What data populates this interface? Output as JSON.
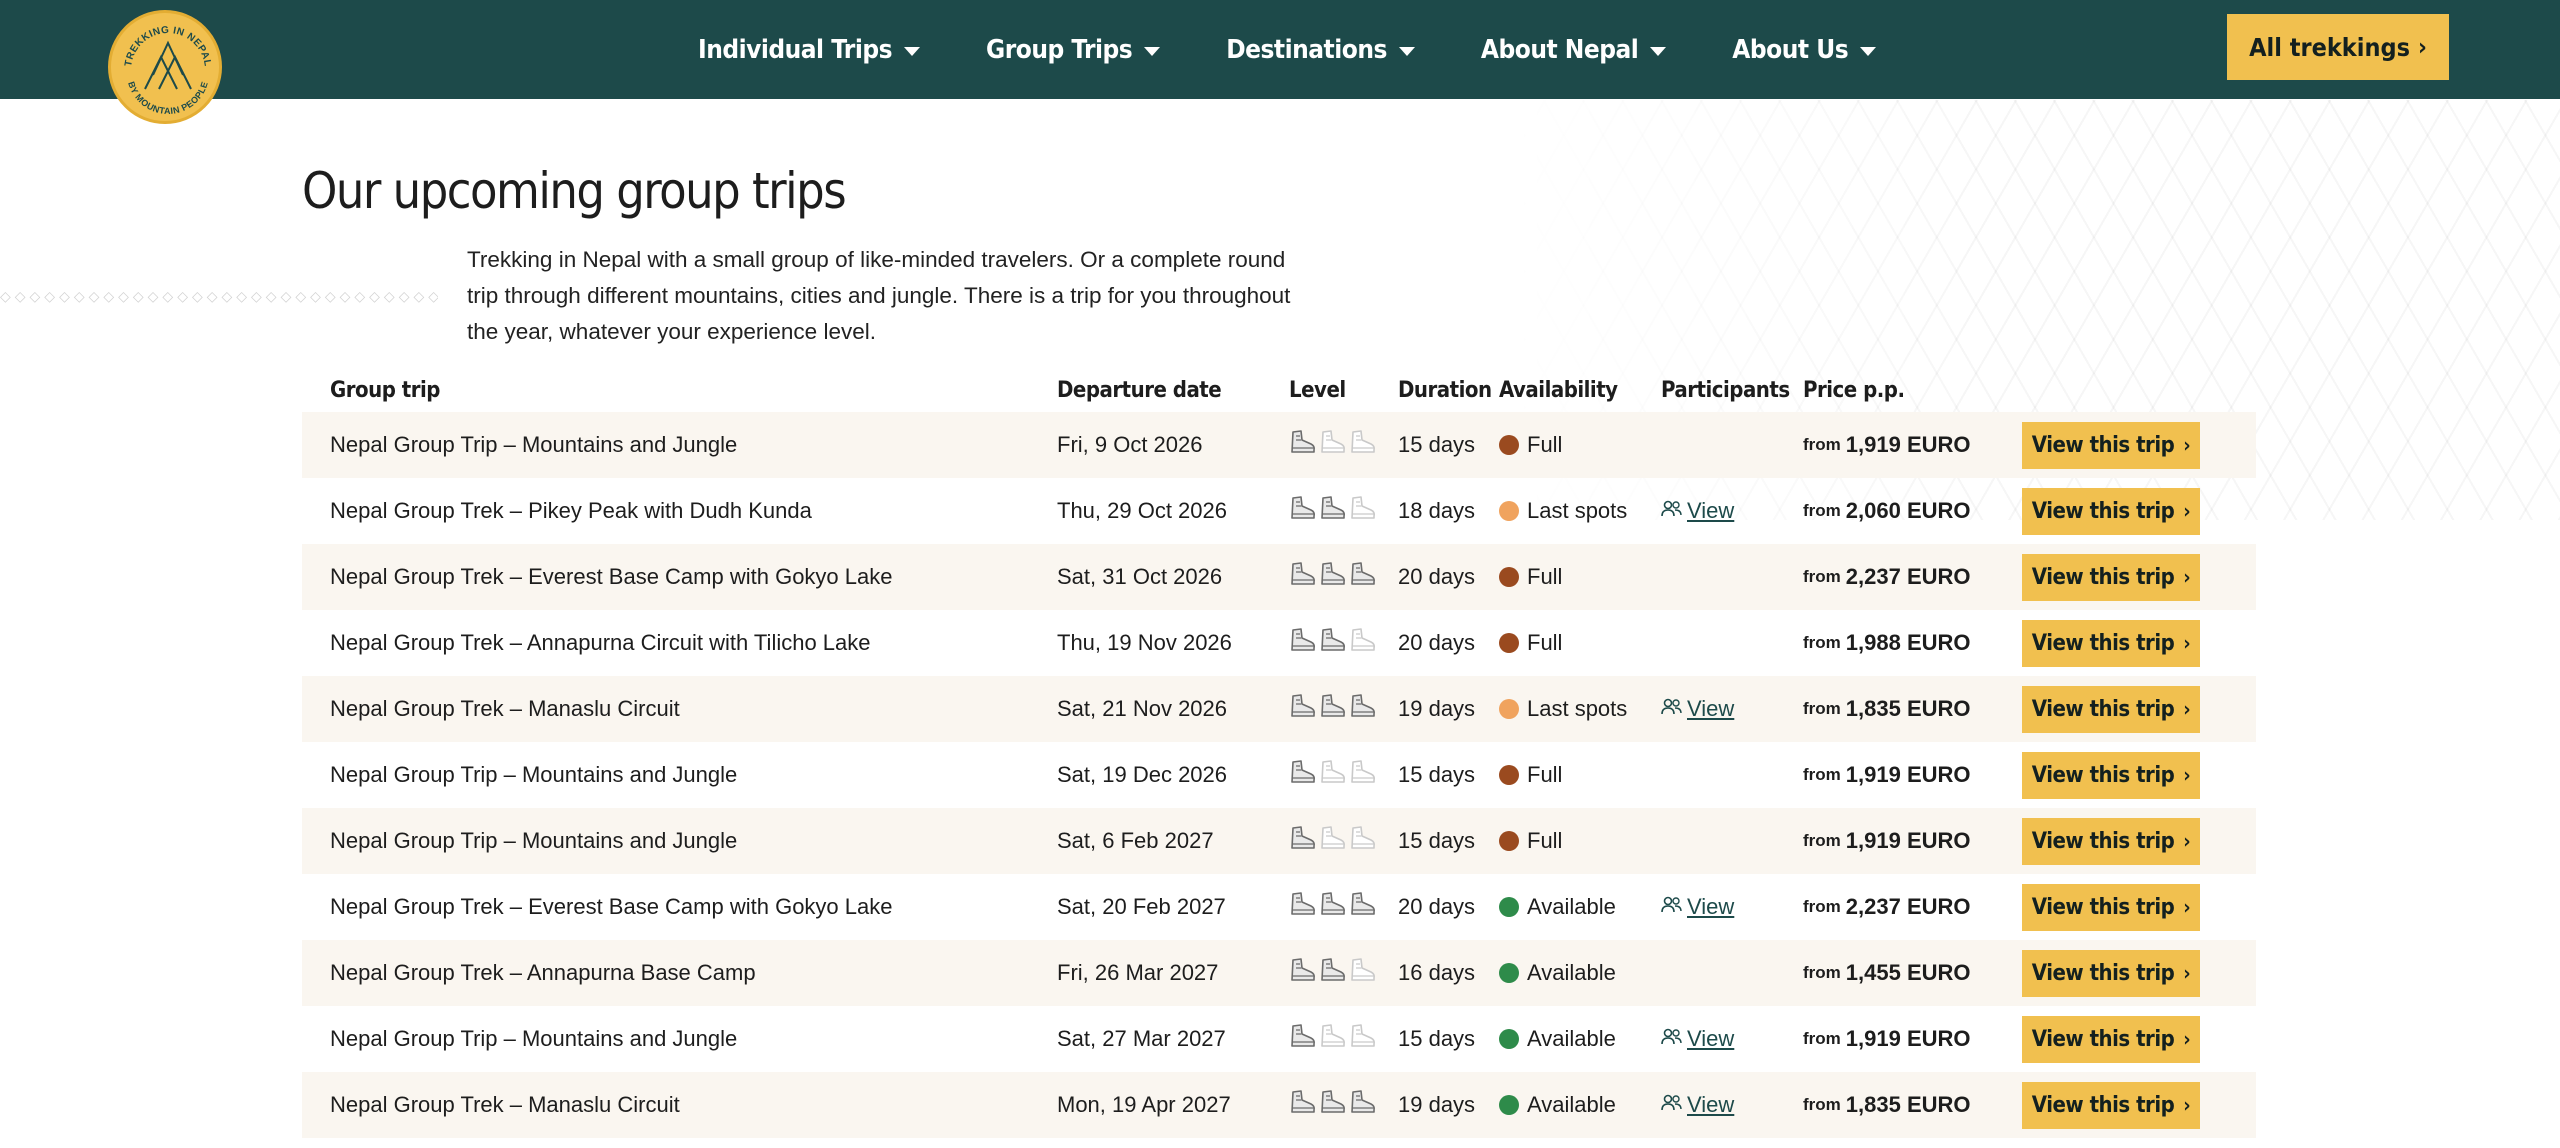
{
  "colors": {
    "nav_bg": "#1d4a4a",
    "accent": "#f1c04f",
    "status_full": "#9a4a1f",
    "status_last_spots": "#f0a35e",
    "status_available": "#2e8b4a"
  },
  "logo": {
    "text_top": "TREKKING IN NEPAL",
    "text_bottom": "BY MOUNTAIN PEOPLE"
  },
  "nav": {
    "items": [
      {
        "label": "Individual Trips"
      },
      {
        "label": "Group Trips"
      },
      {
        "label": "Destinations"
      },
      {
        "label": "About Nepal"
      },
      {
        "label": "About Us"
      }
    ],
    "cta_label": "All trekkings"
  },
  "main": {
    "title": "Our upcoming group trips",
    "intro": "Trekking in Nepal with a small group of like-minded travelers. Or a complete round trip through different mountains, cities and jungle. There is a trip for you throughout the year, whatever your experience level."
  },
  "table": {
    "headers": [
      "Group trip",
      "Departure date",
      "Level",
      "Duration",
      "Availability",
      "Participants",
      "Price p.p."
    ],
    "price_prefix": "from",
    "button_label": "View this trip",
    "participants_link_label": "View",
    "rows": [
      {
        "trip": "Nepal Group Trip – Mountains and Jungle",
        "date": "Fri, 9 Oct 2026",
        "level": 1,
        "duration": "15 days",
        "status": "full",
        "availability": "Full",
        "participants": false,
        "price": "1,919 EURO"
      },
      {
        "trip": "Nepal Group Trek – Pikey Peak with Dudh Kunda",
        "date": "Thu, 29 Oct 2026",
        "level": 2,
        "duration": "18 days",
        "status": "last",
        "availability": "Last spots",
        "participants": true,
        "price": "2,060 EURO"
      },
      {
        "trip": "Nepal Group Trek – Everest Base Camp with Gokyo Lake",
        "date": "Sat, 31 Oct 2026",
        "level": 3,
        "duration": "20 days",
        "status": "full",
        "availability": "Full",
        "participants": false,
        "price": "2,237 EURO"
      },
      {
        "trip": "Nepal Group Trek – Annapurna Circuit with Tilicho Lake",
        "date": "Thu, 19 Nov 2026",
        "level": 2,
        "duration": "20 days",
        "status": "full",
        "availability": "Full",
        "participants": false,
        "price": "1,988 EURO"
      },
      {
        "trip": "Nepal Group Trek – Manaslu Circuit",
        "date": "Sat, 21 Nov 2026",
        "level": 3,
        "duration": "19 days",
        "status": "last",
        "availability": "Last spots",
        "participants": true,
        "price": "1,835 EURO"
      },
      {
        "trip": "Nepal Group Trip – Mountains and Jungle",
        "date": "Sat, 19 Dec 2026",
        "level": 1,
        "duration": "15 days",
        "status": "full",
        "availability": "Full",
        "participants": false,
        "price": "1,919 EURO"
      },
      {
        "trip": "Nepal Group Trip – Mountains and Jungle",
        "date": "Sat, 6 Feb 2027",
        "level": 1,
        "duration": "15 days",
        "status": "full",
        "availability": "Full",
        "participants": false,
        "price": "1,919 EURO"
      },
      {
        "trip": "Nepal Group Trek – Everest Base Camp with Gokyo Lake",
        "date": "Sat, 20 Feb 2027",
        "level": 3,
        "duration": "20 days",
        "status": "available",
        "availability": "Available",
        "participants": true,
        "price": "2,237 EURO"
      },
      {
        "trip": "Nepal Group Trek – Annapurna Base Camp",
        "date": "Fri, 26 Mar 2027",
        "level": 2,
        "duration": "16 days",
        "status": "available",
        "availability": "Available",
        "participants": false,
        "price": "1,455 EURO"
      },
      {
        "trip": "Nepal Group Trip – Mountains and Jungle",
        "date": "Sat, 27 Mar 2027",
        "level": 1,
        "duration": "15 days",
        "status": "available",
        "availability": "Available",
        "participants": true,
        "price": "1,919 EURO"
      },
      {
        "trip": "Nepal Group Trek – Manaslu Circuit",
        "date": "Mon, 19 Apr 2027",
        "level": 3,
        "duration": "19 days",
        "status": "available",
        "availability": "Available",
        "participants": true,
        "price": "1,835 EURO"
      }
    ]
  }
}
